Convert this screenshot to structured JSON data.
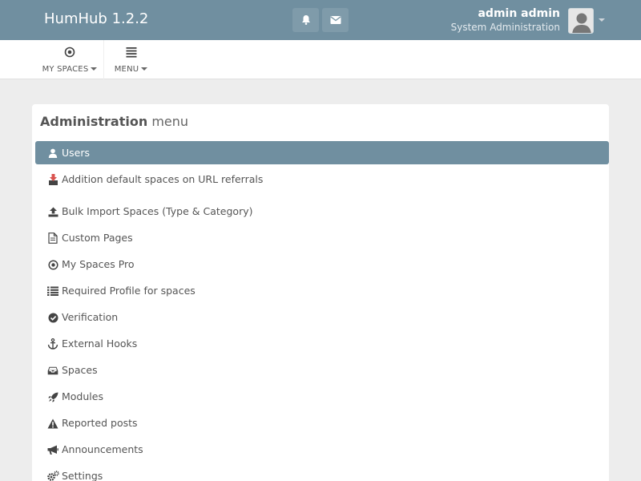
{
  "header": {
    "brand": "HumHub 1.2.2",
    "user_name": "admin admin",
    "user_title": "System Administration",
    "notifications_icon": "bell-icon",
    "messages_icon": "envelope-icon"
  },
  "subnav": {
    "spaces_label": "MY SPACES",
    "menu_label": "MENU"
  },
  "panel": {
    "title_strong": "Administration",
    "title_light": "menu"
  },
  "admin_menu": {
    "items": [
      {
        "label": "Users",
        "icon": "user-icon",
        "active": true
      },
      {
        "label": "Addition default spaces on URL referrals",
        "icon": "download-icon",
        "active": false
      },
      {
        "label": "Bulk Import Spaces (Type & Category)",
        "icon": "upload-icon",
        "active": false
      },
      {
        "label": "Custom Pages",
        "icon": "file-icon",
        "active": false
      },
      {
        "label": "My Spaces Pro",
        "icon": "dot-circle-icon",
        "active": false
      },
      {
        "label": "Required Profile for spaces",
        "icon": "list-icon",
        "active": false
      },
      {
        "label": "Verification",
        "icon": "check-circle-icon",
        "active": false
      },
      {
        "label": "External Hooks",
        "icon": "anchor-icon",
        "active": false
      },
      {
        "label": "Spaces",
        "icon": "inbox-icon",
        "active": false
      },
      {
        "label": "Modules",
        "icon": "rocket-icon",
        "active": false
      },
      {
        "label": "Reported posts",
        "icon": "warning-icon",
        "active": false
      },
      {
        "label": "Announcements",
        "icon": "bullhorn-icon",
        "active": false
      },
      {
        "label": "Settings",
        "icon": "cogs-icon",
        "active": false
      }
    ]
  },
  "colors": {
    "primary": "#708fa0",
    "background": "#ededed",
    "accent_red": "#d9534f"
  }
}
